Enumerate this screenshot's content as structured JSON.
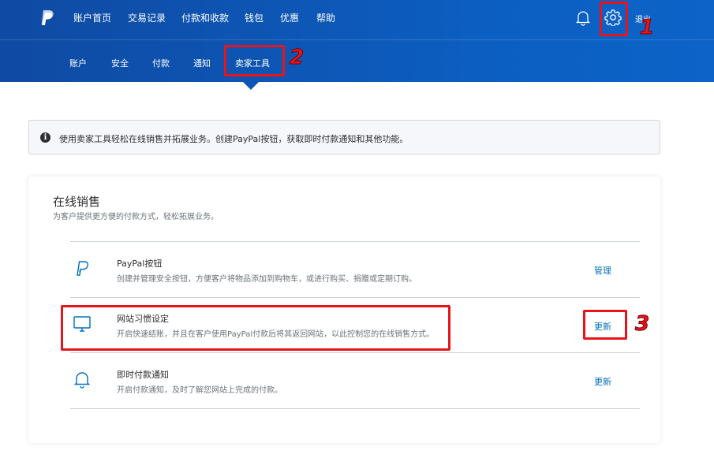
{
  "nav": {
    "items": [
      "账户首页",
      "交易记录",
      "付款和收款",
      "钱包",
      "优惠",
      "帮助"
    ],
    "logout": "退出"
  },
  "subnav": {
    "items": [
      "账户",
      "安全",
      "付款",
      "通知",
      "卖家工具"
    ]
  },
  "annotations": {
    "step1": "1",
    "step2": "2",
    "step3": "3"
  },
  "notice": {
    "icon": "info-icon",
    "text": "使用卖家工具轻松在线销售并拓展业务。创建PayPal按钮，获取即时付款通知和其他功能。"
  },
  "section": {
    "title": "在线销售",
    "subtitle": "为客户提供更方便的付款方式，轻松拓展业务。",
    "rows": [
      {
        "icon": "paypal-icon",
        "title": "PayPal按钮",
        "desc": "创建并管理安全按钮，方便客户将物品添加到购物车，或进行购买、捐赠或定期订购。",
        "action": "管理"
      },
      {
        "icon": "monitor-icon",
        "title": "网站习惯设定",
        "desc": "开启快速结账，并且在客户使用PayPal付款后将其返回网站，以此控制您的在线销售方式。",
        "action": "更新"
      },
      {
        "icon": "bell-icon",
        "title": "即时付款通知",
        "desc": "开启付款通知，及时了解您网站上完成的付款。",
        "action": "更新"
      }
    ]
  },
  "colors": {
    "header": "#0c5fc2",
    "link": "#0070ba",
    "highlight": "#e8141c"
  }
}
